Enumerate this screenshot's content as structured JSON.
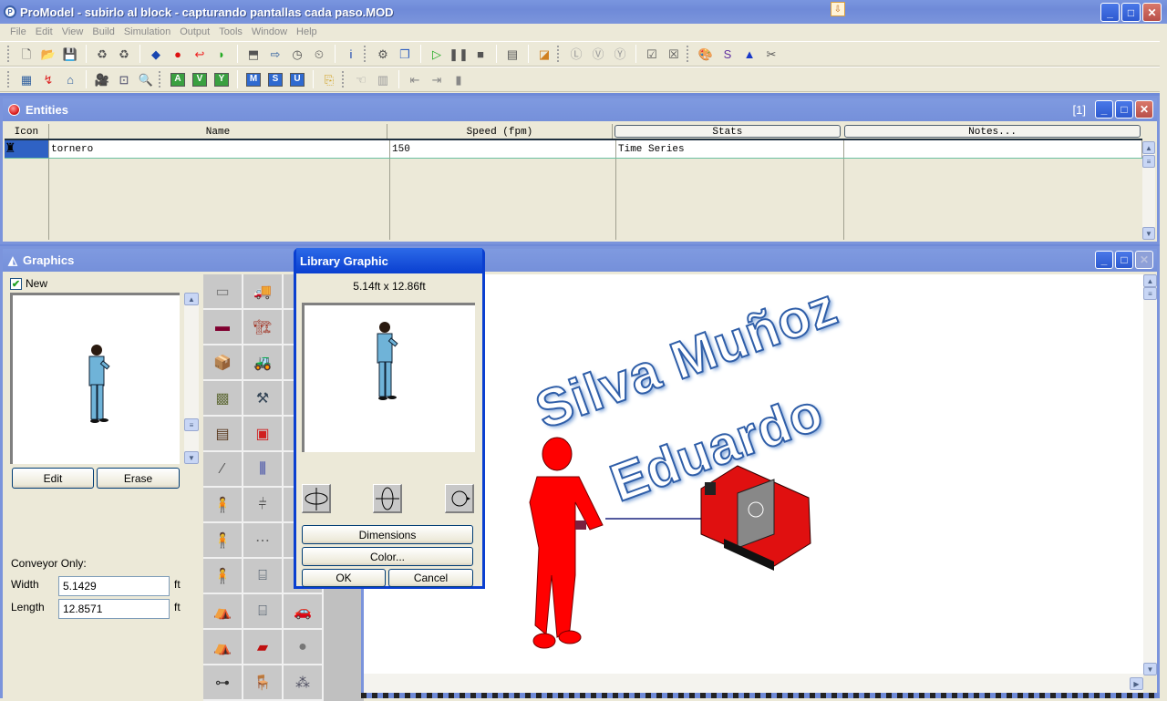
{
  "app": {
    "title": "ProModel - subirlo al block - capturando pantallas cada paso.MOD",
    "window_buttons": {
      "minimize": "_",
      "maximize": "□",
      "close": "✕"
    }
  },
  "menu": [
    "File",
    "Edit",
    "View",
    "Build",
    "Simulation",
    "Output",
    "Tools",
    "Window",
    "Help"
  ],
  "toolbar1": [
    {
      "name": "new-file-icon",
      "glyph": "🗋"
    },
    {
      "name": "open-file-icon",
      "glyph": "📂"
    },
    {
      "name": "save-icon",
      "glyph": "💾"
    },
    {
      "name": "merge-model-icon",
      "glyph": "♻"
    },
    {
      "name": "model-package-icon",
      "glyph": "♻"
    },
    {
      "name": "locations-icon",
      "glyph": "◆"
    },
    {
      "name": "entities-icon",
      "glyph": "●"
    },
    {
      "name": "path-networks-icon",
      "glyph": "↩"
    },
    {
      "name": "resources-icon",
      "glyph": "◗"
    },
    {
      "name": "processing-icon",
      "glyph": "⬒"
    },
    {
      "name": "arrivals-icon",
      "glyph": "⇨"
    },
    {
      "name": "shifts-icon",
      "glyph": "◷"
    },
    {
      "name": "schedule-icon",
      "glyph": "⏲"
    },
    {
      "name": "info-icon",
      "glyph": "i"
    },
    {
      "name": "sim-options-icon",
      "glyph": "⚙"
    },
    {
      "name": "scenarios-icon",
      "glyph": "❐"
    },
    {
      "name": "run-icon",
      "glyph": "▷"
    },
    {
      "name": "pause-icon",
      "glyph": "❚❚"
    },
    {
      "name": "stop-icon",
      "glyph": "■"
    },
    {
      "name": "animation-icon",
      "glyph": "▤"
    },
    {
      "name": "output-viewer-icon",
      "glyph": "◪"
    },
    {
      "name": "stat-fit-l-icon",
      "glyph": "Ⓛ"
    },
    {
      "name": "stat-fit-v-icon",
      "glyph": "Ⓥ"
    },
    {
      "name": "stat-fit-y-icon",
      "glyph": "Ⓨ"
    },
    {
      "name": "chart-check-icon",
      "glyph": "☑"
    },
    {
      "name": "chart-zoom-icon",
      "glyph": "☒"
    },
    {
      "name": "graphic-editor-icon",
      "glyph": "🎨"
    },
    {
      "name": "process-sim-icon",
      "glyph": "S"
    },
    {
      "name": "triangle-icon",
      "glyph": "▲"
    },
    {
      "name": "tools-misc-icon",
      "glyph": "✂"
    }
  ],
  "toolbar2": {
    "layout_group": [
      {
        "name": "grid-icon",
        "glyph": "▦"
      },
      {
        "name": "routing-icon",
        "glyph": "↯"
      },
      {
        "name": "background-icon",
        "glyph": "⌂"
      }
    ],
    "view_group": [
      {
        "name": "camera-icon",
        "glyph": "🎥"
      },
      {
        "name": "zoom-window-icon",
        "glyph": "⊡"
      },
      {
        "name": "magnifier-icon",
        "glyph": "🔍"
      }
    ],
    "letter_green": [
      "A",
      "V",
      "Y"
    ],
    "letter_blue": [
      "M",
      "S",
      "U"
    ],
    "extra": [
      {
        "name": "exit-door-icon",
        "glyph": "⎘"
      },
      {
        "name": "trace-icon",
        "glyph": "☜"
      },
      {
        "name": "debug-icon",
        "glyph": "▥"
      },
      {
        "name": "import-icon",
        "glyph": "⇤"
      },
      {
        "name": "export-icon",
        "glyph": "⇥"
      },
      {
        "name": "table-icon",
        "glyph": "▮"
      }
    ]
  },
  "entities_window": {
    "title": "Entities",
    "count": "[1]",
    "columns": [
      "Icon",
      "Name",
      "Speed (fpm)",
      "Stats",
      "Notes..."
    ],
    "rows": [
      {
        "icon": "worker-figure-icon",
        "name": "tornero",
        "speed": "150",
        "stats": "Time Series",
        "notes": ""
      }
    ]
  },
  "graphics_window": {
    "title": "Graphics",
    "new_label": "New",
    "new_checked": true,
    "edit_label": "Edit",
    "erase_label": "Erase",
    "conveyor_only_label": "Conveyor Only:",
    "width_label": "Width",
    "width_value": "5.1429",
    "length_label": "Length",
    "length_value": "12.8571",
    "unit": "ft",
    "library": [
      {
        "name": "platform-icon",
        "glyph": "▭"
      },
      {
        "name": "truck-icon",
        "glyph": "🚚"
      },
      {
        "name": "cabinet-icon",
        "glyph": "▯"
      },
      {
        "name": "pallet-red-icon",
        "glyph": "▬"
      },
      {
        "name": "forklift-icon",
        "glyph": "🏗"
      },
      {
        "name": "barrel-icon",
        "glyph": "▯"
      },
      {
        "name": "box-icon",
        "glyph": "📦"
      },
      {
        "name": "forklift-orange-icon",
        "glyph": "🚜"
      },
      {
        "name": "machine-icon",
        "glyph": "▯"
      },
      {
        "name": "box-stack-icon",
        "glyph": "▩"
      },
      {
        "name": "hand-truck-icon",
        "glyph": "⚒"
      },
      {
        "name": "robot-icon",
        "glyph": "⚙"
      },
      {
        "name": "wood-pallet-icon",
        "glyph": "▤"
      },
      {
        "name": "agv-icon",
        "glyph": "▣"
      },
      {
        "name": "worker-icon",
        "glyph": "🧍"
      },
      {
        "name": "pipe-icon",
        "glyph": "⁄"
      },
      {
        "name": "conveyor-icon",
        "glyph": "⫼"
      },
      {
        "name": "worker-icon",
        "glyph": "🧍"
      },
      {
        "name": "person-icon",
        "glyph": "🧍"
      },
      {
        "name": "rack-icon",
        "glyph": "⫩"
      },
      {
        "name": "worker-icon",
        "glyph": "🧍"
      },
      {
        "name": "person-icon",
        "glyph": "🧍"
      },
      {
        "name": "rail-icon",
        "glyph": "⋯"
      },
      {
        "name": "crate-icon",
        "glyph": "▯"
      },
      {
        "name": "person-blue-icon",
        "glyph": "🧍"
      },
      {
        "name": "cnc-machine-icon",
        "glyph": "⌸"
      },
      {
        "name": "tank-icon",
        "glyph": "▯"
      },
      {
        "name": "tent-green-icon",
        "glyph": "⛺"
      },
      {
        "name": "press-machine-icon",
        "glyph": "⌸"
      },
      {
        "name": "car-icon",
        "glyph": "🚗"
      },
      {
        "name": "tent-white-icon",
        "glyph": "⛺"
      },
      {
        "name": "lathe-icon",
        "glyph": "▰"
      },
      {
        "name": "disc-icon",
        "glyph": "●"
      },
      {
        "name": "cart-icon",
        "glyph": "⊶"
      },
      {
        "name": "chair-icon",
        "glyph": "🪑"
      },
      {
        "name": "drums-icon",
        "glyph": "⁂"
      }
    ]
  },
  "library_dialog": {
    "title": "Library Graphic",
    "size_text": "5.14ft x 12.86ft",
    "dimensions_label": "Dimensions",
    "color_label": "Color...",
    "ok_label": "OK",
    "cancel_label": "Cancel"
  },
  "canvas": {
    "wordart_line1": "Silva Muñoz",
    "wordart_line2": "Eduardo",
    "worker_color": "#ff0000",
    "lathe_color": "#e01010"
  },
  "colors": {
    "titlebar": "#6f8ad8",
    "dialog_border": "#0a3fd0",
    "selected_cell": "#2f62c4"
  }
}
